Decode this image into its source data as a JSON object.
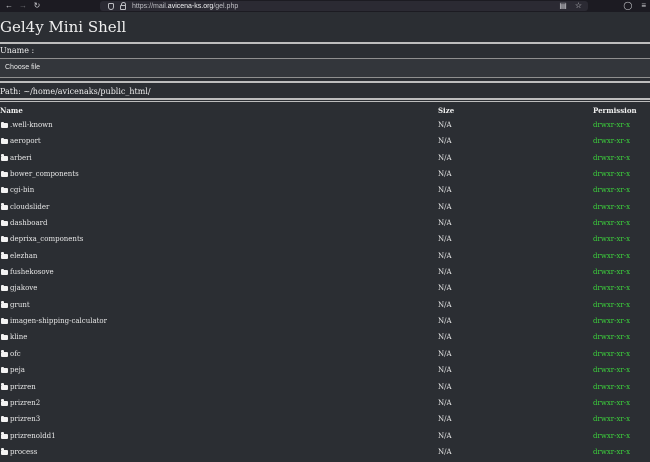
{
  "browser": {
    "url_prefix": "https://mail.",
    "url_domain": "avicena-ks.org",
    "url_path": "/gel.php"
  },
  "page": {
    "title": "Gel4y Mini Shell",
    "uname_label": "Uname :",
    "choose_file_label": "Choose file",
    "path_text": "Path: ~/home/avicenaks/public_html/"
  },
  "table": {
    "headers": {
      "name": "Name",
      "size": "Size",
      "permission": "Permission"
    },
    "rows": [
      {
        "name": ".well-known",
        "size": "N/A",
        "permission": "drwxr-xr-x"
      },
      {
        "name": "aeroport",
        "size": "N/A",
        "permission": "drwxr-xr-x"
      },
      {
        "name": "arberi",
        "size": "N/A",
        "permission": "drwxr-xr-x"
      },
      {
        "name": "bower_components",
        "size": "N/A",
        "permission": "drwxr-xr-x"
      },
      {
        "name": "cgi-bin",
        "size": "N/A",
        "permission": "drwxr-xr-x"
      },
      {
        "name": "cloudslider",
        "size": "N/A",
        "permission": "drwxr-xr-x"
      },
      {
        "name": "dashboard",
        "size": "N/A",
        "permission": "drwxr-xr-x"
      },
      {
        "name": "deprixa_components",
        "size": "N/A",
        "permission": "drwxr-xr-x"
      },
      {
        "name": "elezhan",
        "size": "N/A",
        "permission": "drwxr-xr-x"
      },
      {
        "name": "fushekosove",
        "size": "N/A",
        "permission": "drwxr-xr-x"
      },
      {
        "name": "gjakove",
        "size": "N/A",
        "permission": "drwxr-xr-x"
      },
      {
        "name": "grunt",
        "size": "N/A",
        "permission": "drwxr-xr-x"
      },
      {
        "name": "imagen-shipping-calculator",
        "size": "N/A",
        "permission": "drwxr-xr-x"
      },
      {
        "name": "kline",
        "size": "N/A",
        "permission": "drwxr-xr-x"
      },
      {
        "name": "ofc",
        "size": "N/A",
        "permission": "drwxr-xr-x"
      },
      {
        "name": "peja",
        "size": "N/A",
        "permission": "drwxr-xr-x"
      },
      {
        "name": "prizren",
        "size": "N/A",
        "permission": "drwxr-xr-x"
      },
      {
        "name": "prizren2",
        "size": "N/A",
        "permission": "drwxr-xr-x"
      },
      {
        "name": "prizren3",
        "size": "N/A",
        "permission": "drwxr-xr-x"
      },
      {
        "name": "prizrenoldd1",
        "size": "N/A",
        "permission": "drwxr-xr-x"
      },
      {
        "name": "process",
        "size": "N/A",
        "permission": "drwxr-xr-x"
      }
    ]
  },
  "colors": {
    "background": "#2b2e33",
    "permission_green": "#3cd33c"
  },
  "icons": [
    "back-arrow-icon",
    "forward-arrow-icon",
    "reload-icon",
    "shield-icon",
    "lock-icon",
    "reader-view-icon",
    "bookmark-star-icon",
    "pocket-icon",
    "extensions-icon",
    "folder-icon"
  ]
}
